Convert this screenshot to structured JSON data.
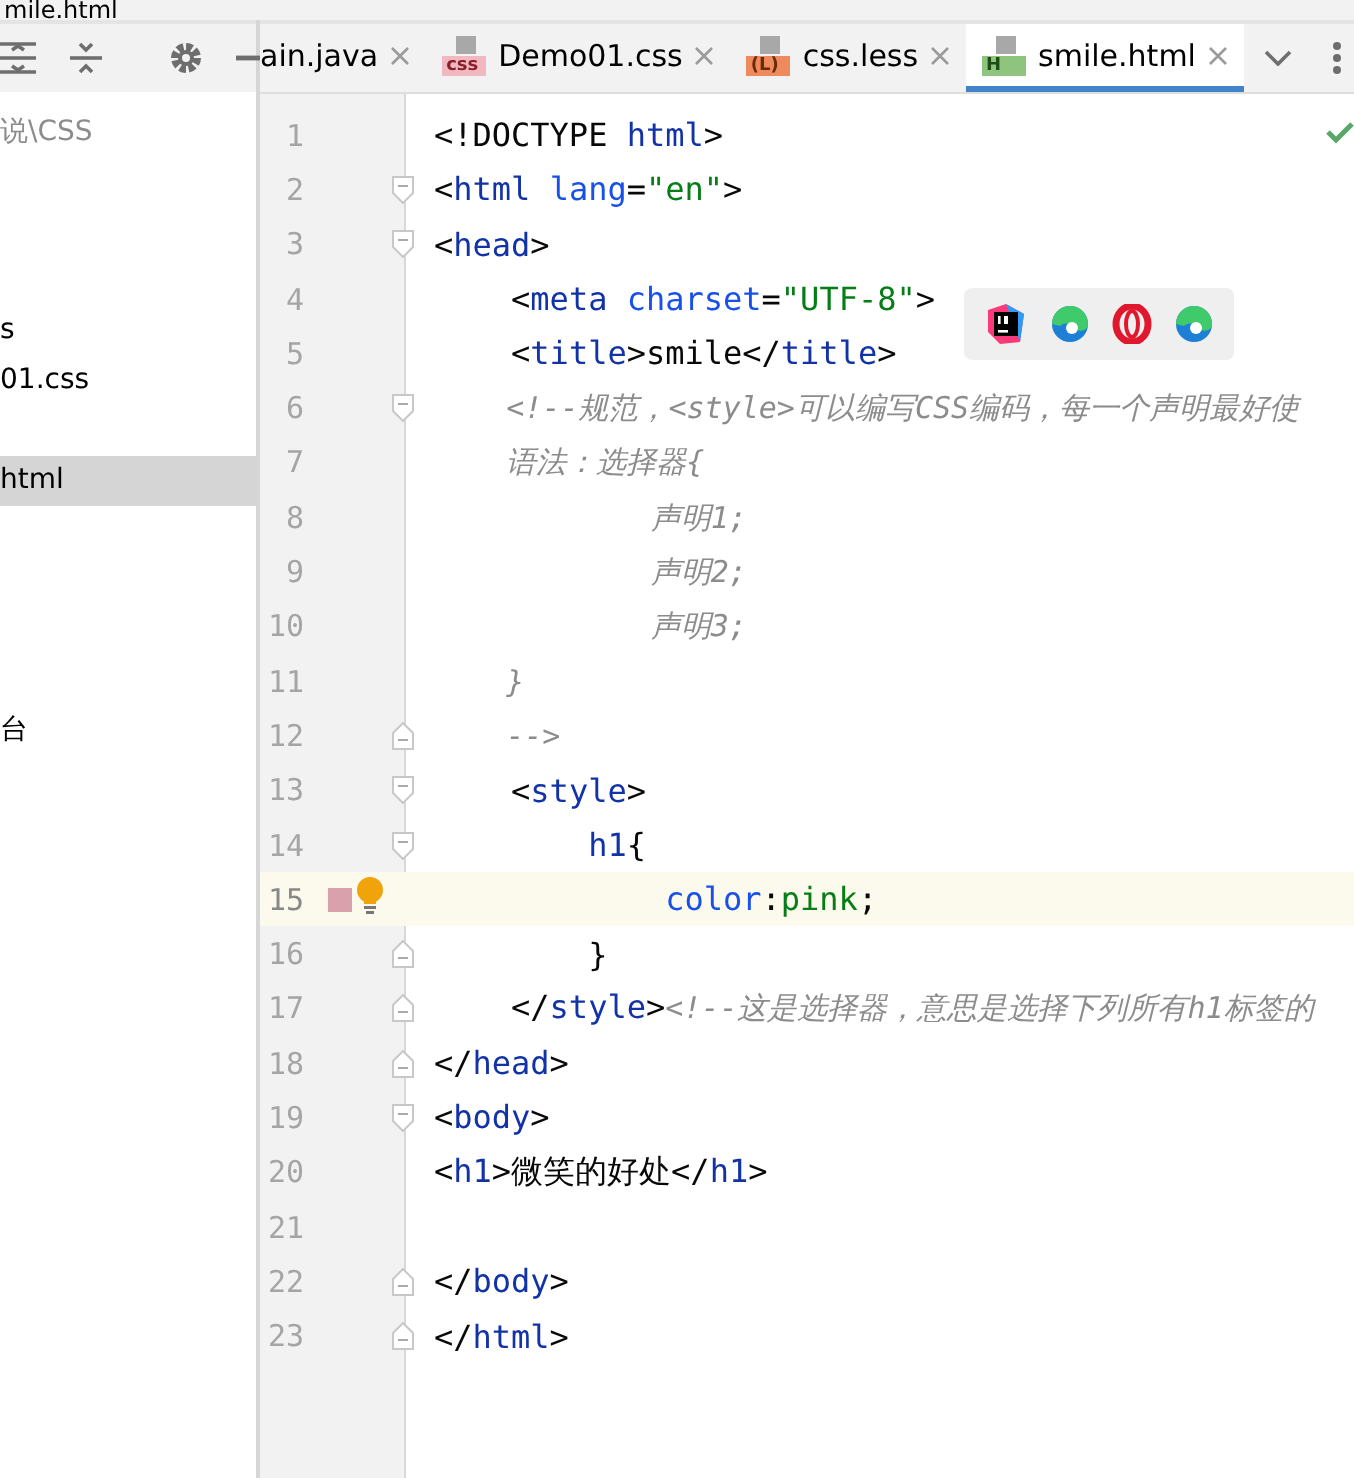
{
  "window": {
    "title": "mile.html"
  },
  "sidebar": {
    "items": [
      {
        "label": "说\\CSS",
        "selected": false
      },
      {
        "label": "s",
        "selected": false
      },
      {
        "label": "01.css",
        "selected": false
      },
      {
        "label": "html",
        "selected": true
      },
      {
        "label": "台",
        "selected": false
      }
    ]
  },
  "tabs": [
    {
      "label": "ain.java",
      "kind": "plain",
      "selected": false
    },
    {
      "label": "Demo01.css",
      "badge": "css",
      "kind": "css",
      "selected": false
    },
    {
      "label": "css.less",
      "badge": "(L)",
      "kind": "less",
      "selected": false
    },
    {
      "label": "smile.html",
      "badge": "H",
      "kind": "html",
      "selected": true
    }
  ],
  "editor": {
    "lines": [
      {
        "number": "1",
        "kind": "plain",
        "current": false,
        "tokens": [
          {
            "kind": "punct",
            "text": "<!DOCTYPE "
          },
          {
            "kind": "tag",
            "text": "html"
          },
          {
            "kind": "punct",
            "text": ">"
          }
        ]
      },
      {
        "number": "2",
        "kind": "fold_start",
        "current": false,
        "tokens": [
          {
            "kind": "punct",
            "text": "<"
          },
          {
            "kind": "tag",
            "text": "html "
          },
          {
            "kind": "attr",
            "text": "lang"
          },
          {
            "kind": "punct",
            "text": "="
          },
          {
            "kind": "string",
            "text": "\"en\""
          },
          {
            "kind": "punct",
            "text": ">"
          }
        ]
      },
      {
        "number": "3",
        "kind": "fold_start",
        "current": false,
        "tokens": [
          {
            "kind": "punct",
            "text": "<"
          },
          {
            "kind": "tag",
            "text": "head"
          },
          {
            "kind": "punct",
            "text": ">"
          }
        ]
      },
      {
        "number": "4",
        "kind": "plain",
        "current": false,
        "tokens": [
          {
            "kind": "punct",
            "text": "    <"
          },
          {
            "kind": "tag",
            "text": "meta "
          },
          {
            "kind": "attr",
            "text": "charset"
          },
          {
            "kind": "punct",
            "text": "="
          },
          {
            "kind": "string",
            "text": "\"UTF-8\""
          },
          {
            "kind": "punct",
            "text": ">"
          }
        ]
      },
      {
        "number": "5",
        "kind": "plain",
        "current": false,
        "tokens": [
          {
            "kind": "punct",
            "text": "    <"
          },
          {
            "kind": "tag",
            "text": "title"
          },
          {
            "kind": "punct",
            "text": ">smile</"
          },
          {
            "kind": "tag",
            "text": "title"
          },
          {
            "kind": "punct",
            "text": ">"
          }
        ]
      },
      {
        "number": "6",
        "kind": "fold_start",
        "current": false,
        "tokens": [
          {
            "kind": "comment",
            "text": "    <!--规范，<style>可以编写CSS编码，每一个声明最好使"
          }
        ]
      },
      {
        "number": "7",
        "kind": "plain",
        "current": false,
        "tokens": [
          {
            "kind": "comment",
            "text": "    语法：选择器{"
          }
        ]
      },
      {
        "number": "8",
        "kind": "plain",
        "current": false,
        "tokens": [
          {
            "kind": "comment",
            "text": "            声明1;"
          }
        ]
      },
      {
        "number": "9",
        "kind": "plain",
        "current": false,
        "tokens": [
          {
            "kind": "comment",
            "text": "            声明2;"
          }
        ]
      },
      {
        "number": "10",
        "kind": "plain",
        "current": false,
        "tokens": [
          {
            "kind": "comment",
            "text": "            声明3;"
          }
        ]
      },
      {
        "number": "11",
        "kind": "plain",
        "current": false,
        "tokens": [
          {
            "kind": "comment",
            "text": "    }"
          }
        ]
      },
      {
        "number": "12",
        "kind": "fold_end",
        "current": false,
        "tokens": [
          {
            "kind": "comment",
            "text": "    -->"
          }
        ]
      },
      {
        "number": "13",
        "kind": "fold_start",
        "current": false,
        "tokens": [
          {
            "kind": "punct",
            "text": "    <"
          },
          {
            "kind": "tag",
            "text": "style"
          },
          {
            "kind": "punct",
            "text": ">"
          }
        ]
      },
      {
        "number": "14",
        "kind": "fold_start",
        "current": false,
        "tokens": [
          {
            "kind": "tag",
            "text": "        h1"
          },
          {
            "kind": "punct",
            "text": "{"
          }
        ]
      },
      {
        "number": "15",
        "kind": "plain",
        "current": true,
        "color": "#d8a1ac",
        "tokens": [
          {
            "kind": "attr",
            "text": "            color"
          },
          {
            "kind": "punct",
            "text": ":"
          },
          {
            "kind": "string",
            "text": "pink"
          },
          {
            "kind": "punct",
            "text": ";"
          }
        ]
      },
      {
        "number": "16",
        "kind": "fold_end",
        "current": false,
        "tokens": [
          {
            "kind": "punct",
            "text": "        }"
          }
        ]
      },
      {
        "number": "17",
        "kind": "fold_end",
        "current": false,
        "tokens": [
          {
            "kind": "punct",
            "text": "    </"
          },
          {
            "kind": "tag",
            "text": "style"
          },
          {
            "kind": "punct",
            "text": ">"
          },
          {
            "kind": "comment",
            "text": "<!--这是选择器，意思是选择下列所有h1标签的"
          }
        ]
      },
      {
        "number": "18",
        "kind": "fold_end",
        "current": false,
        "tokens": [
          {
            "kind": "punct",
            "text": "</"
          },
          {
            "kind": "tag",
            "text": "head"
          },
          {
            "kind": "punct",
            "text": ">"
          }
        ]
      },
      {
        "number": "19",
        "kind": "fold_start",
        "current": false,
        "tokens": [
          {
            "kind": "punct",
            "text": "<"
          },
          {
            "kind": "tag",
            "text": "body"
          },
          {
            "kind": "punct",
            "text": ">"
          }
        ]
      },
      {
        "number": "20",
        "kind": "plain",
        "current": false,
        "tokens": [
          {
            "kind": "punct",
            "text": "<"
          },
          {
            "kind": "tag",
            "text": "h1"
          },
          {
            "kind": "punct",
            "text": ">微笑的好处</"
          },
          {
            "kind": "tag",
            "text": "h1"
          },
          {
            "kind": "punct",
            "text": ">"
          }
        ]
      },
      {
        "number": "21",
        "kind": "plain",
        "current": false
      },
      {
        "number": "22",
        "kind": "fold_end",
        "current": false,
        "tokens": [
          {
            "kind": "punct",
            "text": "</"
          },
          {
            "kind": "tag",
            "text": "body"
          },
          {
            "kind": "punct",
            "text": ">"
          }
        ]
      },
      {
        "number": "23",
        "kind": "fold_end",
        "current": false,
        "tokens": [
          {
            "kind": "punct",
            "text": "</"
          },
          {
            "kind": "tag",
            "text": "html"
          },
          {
            "kind": "punct",
            "text": ">"
          }
        ]
      }
    ]
  }
}
